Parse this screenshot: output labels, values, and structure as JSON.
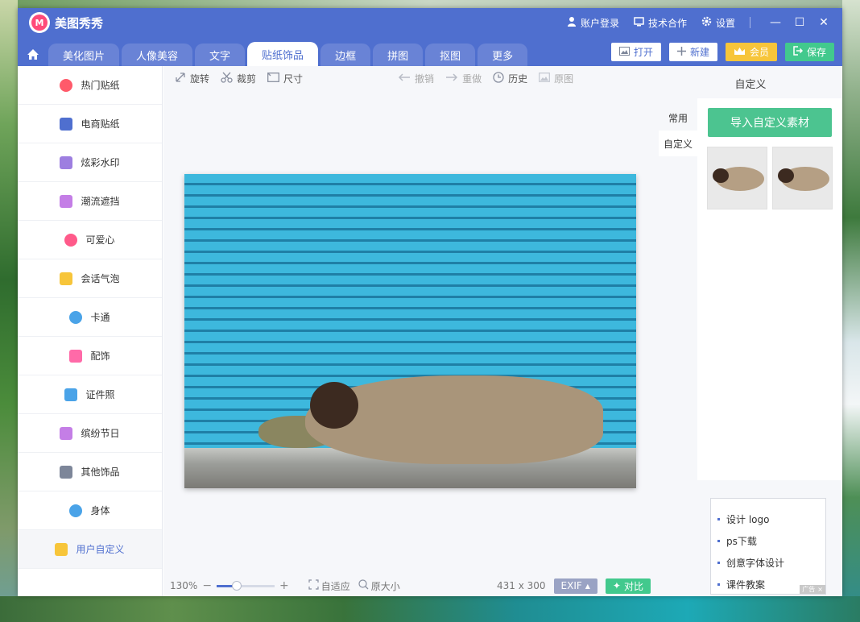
{
  "app": {
    "title": "美图秀秀",
    "logo_text": "M"
  },
  "top_links": {
    "login": "账户登录",
    "tech": "技术合作",
    "settings": "设置"
  },
  "window_controls": {
    "minimize": "—",
    "maximize": "☐",
    "close": "✕"
  },
  "tabs": [
    {
      "label": "美化图片",
      "active": false
    },
    {
      "label": "人像美容",
      "active": false
    },
    {
      "label": "文字",
      "active": false
    },
    {
      "label": "贴纸饰品",
      "active": true
    },
    {
      "label": "边框",
      "active": false
    },
    {
      "label": "拼图",
      "active": false
    },
    {
      "label": "抠图",
      "active": false
    },
    {
      "label": "更多",
      "active": false
    }
  ],
  "tab_buttons": {
    "open": "打开",
    "new": "新建",
    "vip": "会员",
    "save": "保存"
  },
  "sidebar": {
    "items": [
      {
        "label": "热门贴纸",
        "icon": "flame-icon",
        "color": "#ff5a6a"
      },
      {
        "label": "电商贴纸",
        "icon": "cart-icon",
        "color": "#4f6fcf"
      },
      {
        "label": "炫彩水印",
        "icon": "wave-icon",
        "color": "#9d7ee0"
      },
      {
        "label": "潮流遮挡",
        "icon": "slash-icon",
        "color": "#c47ee6"
      },
      {
        "label": "可爱心",
        "icon": "heart-icon",
        "color": "#ff5a8a"
      },
      {
        "label": "会话气泡",
        "icon": "chat-bubble-icon",
        "color": "#f7c53a"
      },
      {
        "label": "卡通",
        "icon": "bear-icon",
        "color": "#4aa3e8"
      },
      {
        "label": "配饰",
        "icon": "bow-icon",
        "color": "#ff6aa8"
      },
      {
        "label": "证件照",
        "icon": "id-photo-icon",
        "color": "#4aa3e8"
      },
      {
        "label": "缤纷节日",
        "icon": "balloon-icon",
        "color": "#c47ee6"
      },
      {
        "label": "其他饰品",
        "icon": "grid-icon",
        "color": "#7d8699"
      },
      {
        "label": "身体",
        "icon": "person-icon",
        "color": "#4aa3e8"
      },
      {
        "label": "用户自定义",
        "icon": "pencil-icon",
        "color": "#f7c53a"
      }
    ]
  },
  "toolbar": {
    "rotate": "旋转",
    "crop": "裁剪",
    "size": "尺寸",
    "undo": "撤销",
    "redo": "重做",
    "history": "历史",
    "original": "原图"
  },
  "bottombar": {
    "zoom": "130%",
    "zoom_level": 0.35,
    "fit": "自适应",
    "actual_size": "原大小",
    "image_size": "431 x 300",
    "exif": "EXIF",
    "compare": "对比"
  },
  "right_panel": {
    "title": "自定义",
    "tabs": [
      {
        "label": "常用",
        "active": false
      },
      {
        "label": "自定义",
        "active": true
      }
    ],
    "import_button": "导入自定义素材",
    "ads": [
      "设计 logo",
      "ps下载",
      "创意字体设计",
      "课件教案"
    ],
    "ad_tag": "广告"
  }
}
